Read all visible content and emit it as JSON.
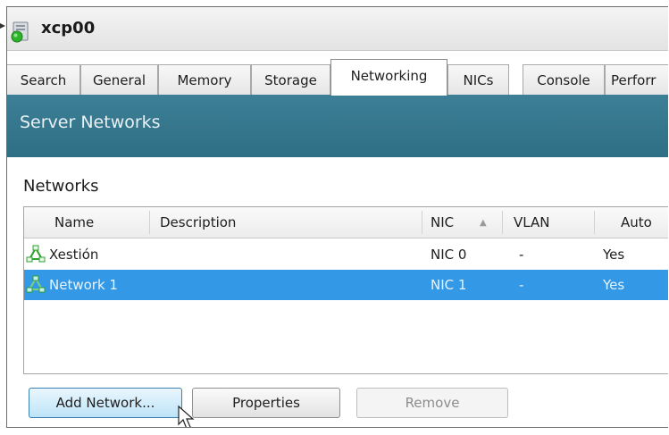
{
  "server": {
    "name": "xcp00",
    "icon": "server-running-icon"
  },
  "tabs": [
    {
      "label": "Search",
      "active": false
    },
    {
      "label": "General",
      "active": false
    },
    {
      "label": "Memory",
      "active": false
    },
    {
      "label": "Storage",
      "active": false
    },
    {
      "label": "Networking",
      "active": true
    },
    {
      "label": "NICs",
      "active": false
    },
    {
      "label": "Console",
      "active": false
    },
    {
      "label": "Perforr",
      "active": false
    }
  ],
  "banner": {
    "title": "Server Networks"
  },
  "networks": {
    "section_title": "Networks",
    "columns": [
      "Name",
      "Description",
      "NIC",
      "VLAN",
      "Auto"
    ],
    "sort_indicator": "▲",
    "rows": [
      {
        "name": "Xestión",
        "description": "",
        "nic": "NIC 0",
        "vlan": "-",
        "auto": "Yes",
        "selected": false,
        "icon": "network-icon"
      },
      {
        "name": "Network 1",
        "description": "",
        "nic": "NIC 1",
        "vlan": "-",
        "auto": "Yes",
        "selected": true,
        "icon": "network-icon"
      }
    ]
  },
  "buttons": {
    "add_network": "Add Network...",
    "properties": "Properties",
    "remove": "Remove"
  },
  "colors": {
    "banner": "#2f7087",
    "selection": "#3399e6",
    "status_green": "#2bb52b"
  }
}
